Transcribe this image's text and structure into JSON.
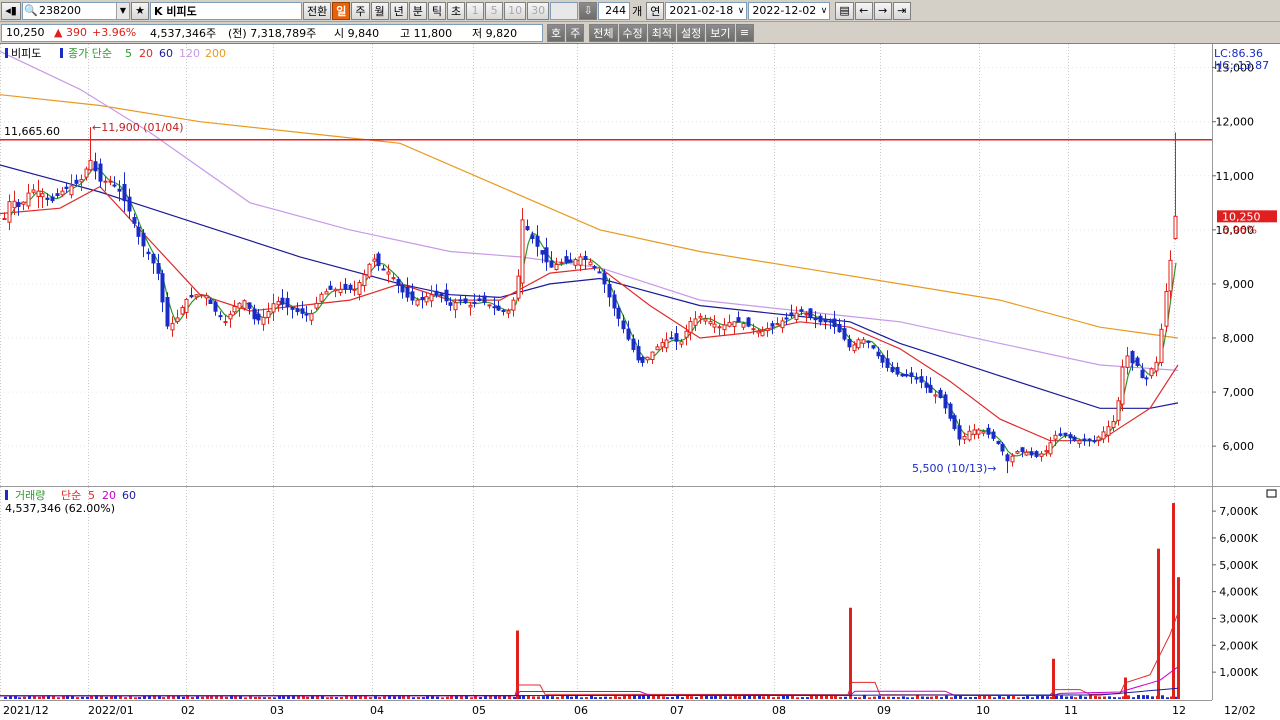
{
  "toolbar": {
    "code": "238200",
    "name": "K 비피도",
    "buttons": [
      "전환",
      "일",
      "주",
      "월",
      "년",
      "분",
      "틱",
      "초"
    ],
    "periods": [
      "1",
      "5",
      "10",
      "30"
    ],
    "count": "244",
    "count_unit": "개",
    "continuous_label": "연",
    "start_date": "2021-02-18",
    "end_date": "2022-12-02"
  },
  "quote": {
    "price": "10,250",
    "change": "▲ 390",
    "change_pct": "+3.96%",
    "volume": "4,537,346주",
    "prev_volume": "(전) 7,318,789주",
    "open": "시 9,840",
    "high": "고 11,800",
    "low": "저 9,820",
    "quote_buttons": [
      "호",
      "주"
    ],
    "menu_buttons": [
      "전체",
      "수정",
      "최적",
      "설정",
      "보기"
    ]
  },
  "legend_price": {
    "name": "비피도",
    "ma_title": "종가 단순",
    "ma5": "5",
    "ma20": "20",
    "ma60": "60",
    "ma120": "120",
    "ma200": "200"
  },
  "legend_volume": {
    "name": "거래량",
    "ma_title": "단순",
    "ma5": "5",
    "ma20": "20",
    "ma60": "60",
    "current": "4,537,346 (62.00%)"
  },
  "price_annotations": {
    "lc": "LC:86.36",
    "hc": "HC:-13.87",
    "hline": "11,665.60",
    "high_mark": "11,900 (01/04)",
    "low_mark": "5,500 (10/13)",
    "last_price": "10,250",
    "last_pct": "3.96%"
  },
  "colors": {
    "up": "#e0201a",
    "down": "#1a2cc8",
    "ma5": "#2a9a2a",
    "ma20": "#e02a2a",
    "ma60": "#1a1a9a",
    "ma120": "#c89ae8",
    "ma200": "#e89a20",
    "hline": "#e02020"
  },
  "chart_data": [
    {
      "type": "candlestick",
      "title": "비피도",
      "ylim": [
        5300,
        13400
      ],
      "y_ticks": [
        "13,000",
        "12,000",
        "11,000",
        "10,000",
        "9,000",
        "8,000",
        "7,000",
        "6,000"
      ],
      "y_tick_values": [
        13000,
        12000,
        11000,
        10000,
        9000,
        8000,
        7000,
        6000
      ],
      "x_ticks": [
        "2021/12",
        "2022/01",
        "02",
        "03",
        "04",
        "05",
        "06",
        "07",
        "08",
        "09",
        "10",
        "11",
        "12",
        "12/02"
      ],
      "last": {
        "open": 9840,
        "high": 11800,
        "low": 9820,
        "close": 10250
      },
      "period_high": {
        "value": 11900,
        "date": "01/04"
      },
      "period_low": {
        "value": 5500,
        "date": "10/13"
      },
      "horizontal_line": 11665.6,
      "close_path": [
        [
          0,
          9950
        ],
        [
          10,
          10600
        ],
        [
          20,
          10400
        ],
        [
          30,
          10750
        ],
        [
          41,
          10700
        ],
        [
          50,
          10500
        ],
        [
          60,
          10700
        ],
        [
          70,
          10800
        ],
        [
          80,
          10900
        ],
        [
          90,
          11300
        ],
        [
          100,
          10900
        ],
        [
          110,
          10900
        ],
        [
          120,
          10700
        ],
        [
          130,
          10300
        ],
        [
          140,
          9800
        ],
        [
          150,
          9500
        ],
        [
          160,
          9100
        ],
        [
          165,
          8200
        ],
        [
          175,
          8300
        ],
        [
          185,
          8700
        ],
        [
          195,
          8800
        ],
        [
          205,
          8800
        ],
        [
          215,
          8500
        ],
        [
          225,
          8300
        ],
        [
          235,
          8600
        ],
        [
          245,
          8700
        ],
        [
          255,
          8300
        ],
        [
          265,
          8400
        ],
        [
          275,
          8700
        ],
        [
          285,
          8600
        ],
        [
          295,
          8500
        ],
        [
          310,
          8400
        ],
        [
          320,
          8800
        ],
        [
          330,
          8900
        ],
        [
          340,
          8900
        ],
        [
          355,
          8900
        ],
        [
          365,
          9200
        ],
        [
          372,
          9500
        ],
        [
          380,
          9300
        ],
        [
          390,
          9200
        ],
        [
          400,
          8900
        ],
        [
          410,
          8700
        ],
        [
          420,
          8700
        ],
        [
          430,
          8800
        ],
        [
          440,
          8800
        ],
        [
          450,
          8600
        ],
        [
          460,
          8700
        ],
        [
          470,
          8600
        ],
        [
          480,
          8700
        ],
        [
          490,
          8600
        ],
        [
          500,
          8500
        ],
        [
          510,
          8500
        ],
        [
          517,
          9000
        ],
        [
          522,
          10200
        ],
        [
          530,
          9900
        ],
        [
          540,
          9600
        ],
        [
          550,
          9300
        ],
        [
          560,
          9400
        ],
        [
          570,
          9400
        ],
        [
          580,
          9500
        ],
        [
          590,
          9400
        ],
        [
          600,
          9200
        ],
        [
          610,
          8700
        ],
        [
          620,
          8300
        ],
        [
          630,
          7900
        ],
        [
          640,
          7500
        ],
        [
          650,
          7700
        ],
        [
          660,
          7900
        ],
        [
          670,
          8000
        ],
        [
          680,
          7900
        ],
        [
          690,
          8300
        ],
        [
          700,
          8400
        ],
        [
          710,
          8300
        ],
        [
          720,
          8200
        ],
        [
          730,
          8300
        ],
        [
          740,
          8300
        ],
        [
          750,
          8200
        ],
        [
          760,
          8100
        ],
        [
          770,
          8200
        ],
        [
          780,
          8300
        ],
        [
          790,
          8400
        ],
        [
          800,
          8500
        ],
        [
          810,
          8400
        ],
        [
          820,
          8300
        ],
        [
          830,
          8300
        ],
        [
          840,
          8100
        ],
        [
          850,
          7800
        ],
        [
          860,
          8000
        ],
        [
          870,
          7900
        ],
        [
          880,
          7600
        ],
        [
          890,
          7400
        ],
        [
          900,
          7300
        ],
        [
          910,
          7300
        ],
        [
          920,
          7200
        ],
        [
          930,
          7000
        ],
        [
          940,
          6900
        ],
        [
          950,
          6500
        ],
        [
          960,
          6100
        ],
        [
          970,
          6300
        ],
        [
          980,
          6300
        ],
        [
          990,
          6200
        ],
        [
          1000,
          6000
        ],
        [
          1008,
          5700
        ],
        [
          1015,
          5900
        ],
        [
          1025,
          5900
        ],
        [
          1035,
          5800
        ],
        [
          1045,
          5900
        ],
        [
          1055,
          6200
        ],
        [
          1065,
          6200
        ],
        [
          1075,
          6100
        ],
        [
          1085,
          6100
        ],
        [
          1095,
          6100
        ],
        [
          1105,
          6300
        ],
        [
          1115,
          6500
        ],
        [
          1125,
          7800
        ],
        [
          1130,
          7500
        ],
        [
          1135,
          7600
        ],
        [
          1140,
          7300
        ],
        [
          1145,
          7200
        ],
        [
          1150,
          7400
        ],
        [
          1158,
          7600
        ],
        [
          1163,
          8600
        ],
        [
          1168,
          9100
        ],
        [
          1173,
          9800
        ],
        [
          1178,
          10250
        ]
      ],
      "ma_paths": {
        "ma20": [
          [
            0,
            10300
          ],
          [
            60,
            10400
          ],
          [
            100,
            10800
          ],
          [
            140,
            10000
          ],
          [
            200,
            8800
          ],
          [
            250,
            8500
          ],
          [
            300,
            8600
          ],
          [
            350,
            8700
          ],
          [
            400,
            9000
          ],
          [
            450,
            8700
          ],
          [
            500,
            8700
          ],
          [
            550,
            9200
          ],
          [
            600,
            9300
          ],
          [
            650,
            8600
          ],
          [
            700,
            8000
          ],
          [
            750,
            8100
          ],
          [
            800,
            8300
          ],
          [
            850,
            8200
          ],
          [
            900,
            7800
          ],
          [
            950,
            7200
          ],
          [
            1000,
            6500
          ],
          [
            1050,
            6100
          ],
          [
            1100,
            6100
          ],
          [
            1150,
            6700
          ],
          [
            1178,
            7500
          ]
        ],
        "ma60": [
          [
            0,
            11200
          ],
          [
            60,
            10900
          ],
          [
            100,
            10700
          ],
          [
            200,
            10100
          ],
          [
            300,
            9500
          ],
          [
            400,
            9000
          ],
          [
            450,
            8800
          ],
          [
            500,
            8750
          ],
          [
            550,
            9000
          ],
          [
            600,
            9100
          ],
          [
            700,
            8600
          ],
          [
            800,
            8400
          ],
          [
            850,
            8300
          ],
          [
            900,
            7900
          ],
          [
            950,
            7600
          ],
          [
            1000,
            7300
          ],
          [
            1050,
            7000
          ],
          [
            1100,
            6700
          ],
          [
            1150,
            6700
          ],
          [
            1178,
            6800
          ]
        ],
        "ma120": [
          [
            0,
            13300
          ],
          [
            80,
            12600
          ],
          [
            150,
            11800
          ],
          [
            250,
            10500
          ],
          [
            350,
            10000
          ],
          [
            450,
            9600
          ],
          [
            520,
            9500
          ],
          [
            600,
            9300
          ],
          [
            700,
            8700
          ],
          [
            800,
            8500
          ],
          [
            900,
            8300
          ],
          [
            1000,
            7900
          ],
          [
            1100,
            7500
          ],
          [
            1178,
            7400
          ]
        ],
        "ma200": [
          [
            0,
            12500
          ],
          [
            100,
            12300
          ],
          [
            200,
            12000
          ],
          [
            300,
            11800
          ],
          [
            400,
            11600
          ],
          [
            500,
            10800
          ],
          [
            600,
            10000
          ],
          [
            700,
            9600
          ],
          [
            800,
            9300
          ],
          [
            900,
            9000
          ],
          [
            1000,
            8700
          ],
          [
            1100,
            8200
          ],
          [
            1178,
            8000
          ]
        ]
      }
    },
    {
      "type": "bar",
      "title": "거래량",
      "ylim": [
        0,
        7600000
      ],
      "y_ticks": [
        "7,000K",
        "6,000K",
        "5,000K",
        "4,000K",
        "3,000K",
        "2,000K",
        "1,000K"
      ],
      "y_tick_values": [
        7000000,
        6000000,
        5000000,
        4000000,
        3000000,
        2000000,
        1000000
      ],
      "spikes": [
        {
          "x": 517,
          "value": 2550000
        },
        {
          "x": 850,
          "value": 3400000
        },
        {
          "x": 1053,
          "value": 1500000
        },
        {
          "x": 1125,
          "value": 800000
        },
        {
          "x": 1158,
          "value": 5600000
        },
        {
          "x": 1173,
          "value": 7300000
        },
        {
          "x": 1178,
          "value": 4537346
        }
      ],
      "current": 4537346
    }
  ]
}
